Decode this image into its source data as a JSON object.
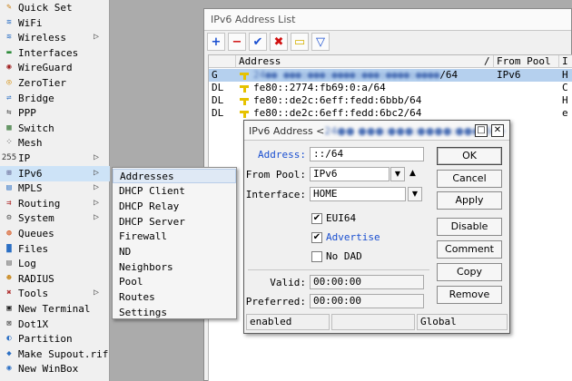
{
  "sidebar": {
    "items": [
      {
        "label": "Quick Set",
        "icon": "quick-set-icon",
        "glyph": "✎",
        "color": "#c77a0a",
        "submenu": false
      },
      {
        "label": "WiFi",
        "icon": "wifi-icon",
        "glyph": "≋",
        "color": "#2b6fc4",
        "submenu": false
      },
      {
        "label": "Wireless",
        "icon": "wireless-icon",
        "glyph": "≋",
        "color": "#2b6fc4",
        "submenu": true
      },
      {
        "label": "Interfaces",
        "icon": "interfaces-icon",
        "glyph": "▬",
        "color": "#2e8b3a",
        "submenu": false
      },
      {
        "label": "WireGuard",
        "icon": "wireguard-icon",
        "glyph": "◉",
        "color": "#a02020",
        "submenu": false
      },
      {
        "label": "ZeroTier",
        "icon": "zerotier-icon",
        "glyph": "◎",
        "color": "#d48a00",
        "submenu": false
      },
      {
        "label": "Bridge",
        "icon": "bridge-icon",
        "glyph": "⇌",
        "color": "#2b6fc4",
        "submenu": false
      },
      {
        "label": "PPP",
        "icon": "ppp-icon",
        "glyph": "⇆",
        "color": "#555555",
        "submenu": false
      },
      {
        "label": "Switch",
        "icon": "switch-icon",
        "glyph": "▦",
        "color": "#3a7a3a",
        "submenu": false
      },
      {
        "label": "Mesh",
        "icon": "mesh-icon",
        "glyph": "⁘",
        "color": "#444444",
        "submenu": false
      },
      {
        "label": "IP",
        "icon": "ip-icon",
        "glyph": "255",
        "color": "#333333",
        "submenu": true
      },
      {
        "label": "IPv6",
        "icon": "ipv6-icon",
        "glyph": "⊞",
        "color": "#5a5a8a",
        "submenu": true
      },
      {
        "label": "MPLS",
        "icon": "mpls-icon",
        "glyph": "▤",
        "color": "#2b6fc4",
        "submenu": true
      },
      {
        "label": "Routing",
        "icon": "routing-icon",
        "glyph": "⇉",
        "color": "#b03030",
        "submenu": true
      },
      {
        "label": "System",
        "icon": "system-icon",
        "glyph": "⚙",
        "color": "#555555",
        "submenu": true
      },
      {
        "label": "Queues",
        "icon": "queues-icon",
        "glyph": "◍",
        "color": "#d44000",
        "submenu": false
      },
      {
        "label": "Files",
        "icon": "files-icon",
        "glyph": "▇",
        "color": "#2b6fc4",
        "submenu": false
      },
      {
        "label": "Log",
        "icon": "log-icon",
        "glyph": "▤",
        "color": "#666666",
        "submenu": false
      },
      {
        "label": "RADIUS",
        "icon": "radius-icon",
        "glyph": "☻",
        "color": "#c47a00",
        "submenu": false
      },
      {
        "label": "Tools",
        "icon": "tools-icon",
        "glyph": "✖",
        "color": "#b03030",
        "submenu": true
      },
      {
        "label": "New Terminal",
        "icon": "terminal-icon",
        "glyph": "▣",
        "color": "#222222",
        "submenu": false
      },
      {
        "label": "Dot1X",
        "icon": "dot1x-icon",
        "glyph": "⊠",
        "color": "#3a3a3a",
        "submenu": false
      },
      {
        "label": "Partition",
        "icon": "partition-icon",
        "glyph": "◐",
        "color": "#2b6fc4",
        "submenu": false
      },
      {
        "label": "Make Supout.rif",
        "icon": "supout-icon",
        "glyph": "◆",
        "color": "#2b6fc4",
        "submenu": false
      },
      {
        "label": "New WinBox",
        "icon": "winbox-icon",
        "glyph": "◉",
        "color": "#2b6fc4",
        "submenu": false
      }
    ]
  },
  "submenu": {
    "items": [
      "Addresses",
      "DHCP Client",
      "DHCP Relay",
      "DHCP Server",
      "Firewall",
      "ND",
      "Neighbors",
      "Pool",
      "Routes",
      "Settings"
    ]
  },
  "address_list": {
    "title": "IPv6 Address List",
    "toolbar": {
      "add": "+",
      "remove": "−",
      "enable": "✔",
      "disable": "✖",
      "comment": "▭",
      "filter": "▽",
      "colors": {
        "add": "#1a4fd0",
        "remove": "#d01010",
        "enable": "#1a4fd0",
        "disable": "#d01010",
        "comment": "#d4b000",
        "filter": "#1a4fd0"
      }
    },
    "columns": [
      "Address",
      "/",
      "From Pool",
      "I"
    ],
    "rows": [
      {
        "flag": "G",
        "address_blurred": "24●● ●●●:●●●:●●●●:●●●:●●●●:●●●●",
        "address_suffix": "/64",
        "pool": "IPv6",
        "iface": "H",
        "selected": true,
        "blurred": true
      },
      {
        "flag": "DL",
        "address": "fe80::2774:fb69:0:a/64",
        "pool": "",
        "iface": "C",
        "selected": false,
        "blurred": false
      },
      {
        "flag": "DL",
        "address": "fe80::de2c:6eff:fedd:6bbb/64",
        "pool": "",
        "iface": "H",
        "selected": false,
        "blurred": false
      },
      {
        "flag": "DL",
        "address": "fe80::de2c:6eff:fedd:6bc2/64",
        "pool": "",
        "iface": "e",
        "selected": false,
        "blurred": false
      }
    ]
  },
  "dialog": {
    "title": "IPv6 Address <",
    "title_blurred": "24●● ●●●:●●●:●●●●:●●●/64>",
    "restore_btn": "□",
    "close_btn": "✕",
    "address_label": "Address:",
    "address_value": "::/64",
    "from_pool_label": "From Pool:",
    "from_pool_value": "IPv6",
    "interface_label": "Interface:",
    "interface_value": "HOME",
    "eui64_label": "EUI64",
    "eui64_checked": true,
    "advertise_label": "Advertise",
    "advertise_checked": true,
    "no_dad_label": "No DAD",
    "no_dad_checked": false,
    "valid_label": "Valid:",
    "valid_value": "00:00:00",
    "preferred_label": "Preferred:",
    "preferred_value": "00:00:00",
    "check_glyph": "✔",
    "buttons": {
      "ok": "OK",
      "cancel": "Cancel",
      "apply": "Apply",
      "disable": "Disable",
      "comment": "Comment",
      "copy": "Copy",
      "remove": "Remove"
    },
    "status": {
      "left": "enabled",
      "middle": "",
      "right": "Global"
    }
  }
}
